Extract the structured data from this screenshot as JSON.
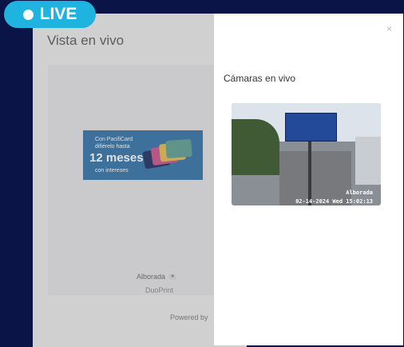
{
  "live_badge": {
    "label": "LIVE"
  },
  "background": {
    "title": "Vista en vivo",
    "banner": {
      "line1": "Con PacifiCard",
      "line2": "difiérelo hasta",
      "line3": "12 meses",
      "line4": "con intereses"
    },
    "location": "Alborada",
    "location_icon": "video-camera-icon",
    "sublocation": "DuoPrint",
    "powered_by": "Powered by"
  },
  "panel": {
    "close_label": "×",
    "title": "Cámaras en vivo",
    "camera": {
      "location": "Alborada",
      "timestamp": "02-14-2024 Wed 15:02:13"
    }
  },
  "colors": {
    "live_badge": "#1fb3e0",
    "background_dark": "#0b1446",
    "banner": "#2d6fa4"
  }
}
